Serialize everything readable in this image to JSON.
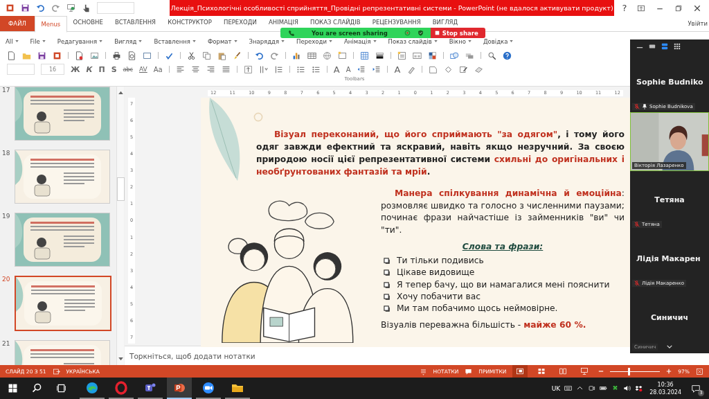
{
  "title_bar": {
    "title": "Лекція_Психологічні особливості сприйняття_Провідні репрезентативні системи -  PowerPoint (не вдалося активувати продукт)",
    "help": "?"
  },
  "ribbon_tabs": [
    {
      "label": "ФАЙЛ",
      "kind": "file",
      "selected": false
    },
    {
      "label": "Menus",
      "kind": "tab",
      "selected": true
    },
    {
      "label": "ОСНОВНЕ",
      "kind": "tab",
      "selected": false
    },
    {
      "label": "ВСТАВЛЕННЯ",
      "kind": "tab",
      "selected": false
    },
    {
      "label": "КОНСТРУКТОР",
      "kind": "tab",
      "selected": false
    },
    {
      "label": "ПЕРЕХОДИ",
      "kind": "tab",
      "selected": false
    },
    {
      "label": "АНІМАЦІЯ",
      "kind": "tab",
      "selected": false
    },
    {
      "label": "ПОКАЗ СЛАЙДІВ",
      "kind": "tab",
      "selected": false
    },
    {
      "label": "РЕЦЕНЗУВАННЯ",
      "kind": "tab",
      "selected": false
    },
    {
      "label": "ВИГЛЯД",
      "kind": "tab",
      "selected": false
    }
  ],
  "sign_in": "Увійти",
  "share_bar": {
    "status": "You are screen sharing",
    "stop": "Stop share"
  },
  "menus": [
    "All",
    "File",
    "Редагування",
    "Вигляд",
    "Вставлення",
    "Формат",
    "Знаряддя",
    "Переходи",
    "Анімація",
    "Показ слайдів",
    "Вікно",
    "Довідка"
  ],
  "font_size": "16",
  "format_buttons": [
    {
      "label": "Ж",
      "kind": "bold"
    },
    {
      "label": "К",
      "kind": "italic"
    },
    {
      "label": "П",
      "kind": "underline"
    },
    {
      "label": "S",
      "kind": "shadow"
    },
    {
      "label": "abc",
      "kind": "strike"
    },
    {
      "label": "AV",
      "kind": "spacing"
    },
    {
      "label": "Aa",
      "kind": "case"
    }
  ],
  "size_buttons": [
    {
      "label": "A",
      "kind": "grow"
    },
    {
      "label": "A",
      "kind": "shrink"
    }
  ],
  "font_color": "A",
  "toolbars_label": "Toolbars",
  "slides": [
    {
      "number": "17",
      "selected": false,
      "kind": "teal"
    },
    {
      "number": "18",
      "selected": false,
      "kind": "cream"
    },
    {
      "number": "19",
      "selected": false,
      "kind": "teal"
    },
    {
      "number": "20",
      "selected": true,
      "kind": "cream"
    },
    {
      "number": "21",
      "selected": false,
      "kind": "cream"
    }
  ],
  "ruler": {
    "horizontal": [
      "12",
      "11",
      "10",
      "9",
      "8",
      "7",
      "6",
      "5",
      "4",
      "3",
      "2",
      "1",
      "0",
      "1",
      "2",
      "3",
      "4",
      "5",
      "6",
      "7",
      "8",
      "9",
      "10",
      "11",
      "12"
    ],
    "vertical": [
      "7",
      "6",
      "5",
      "4",
      "3",
      "2",
      "1",
      "0",
      "1",
      "2",
      "3",
      "4",
      "5",
      "6",
      "7"
    ]
  },
  "slide": {
    "intro": "**Візуал переконаний, що його сприймають \"за одягом\"**, і тому його одяг завжди ефектний та яскравий, навіть якщо незручний. За своєю природою носії цієї репрезентативної системи **схильні до оригінальних і необґрунтованих фантазій та мрій**.",
    "manner": "**Манера спілкування динамічна й емоційна**: розмовляє швидко та голосно з численними паузами; починає фрази найчастіше із займенників \"ви\" чи \"ти\".",
    "heading": "Слова та фрази:",
    "phrases": [
      "Ти тільки подивись",
      "Цікаве видовище",
      "Я тепер бачу, що ви намагалися мені пояснити",
      "Хочу побачити вас",
      "Ми там побачимо щось неймовірне."
    ],
    "summary": "Візуалів переважна більшість - **майже 60 %.**"
  },
  "notes_placeholder": "Торкніться, щоб додати нотатки",
  "participants": [
    {
      "kind": "name",
      "display_name": "Sophie Budniko",
      "label": "Sophie Budnikova",
      "muted": true,
      "pinned": true,
      "active": false
    },
    {
      "kind": "video",
      "label": "Вікторія Лазаренко",
      "muted": false,
      "pinned": false,
      "active": true
    },
    {
      "kind": "name",
      "display_name": "Тетяна",
      "label": "Тетяна",
      "muted": true,
      "pinned": false,
      "active": false
    },
    {
      "kind": "name",
      "display_name": "Лідія Макарен",
      "label": "Лідія Макаренко",
      "muted": true,
      "pinned": false,
      "active": false
    },
    {
      "kind": "name",
      "display_name": "Синичич",
      "label": "Синичич",
      "muted": false,
      "pinned": false,
      "active": false
    }
  ],
  "status_bar": {
    "slide": "СЛАЙД 20 З 51",
    "language": "УКРАЇНСЬКА",
    "notes": "НОТАТКИ",
    "comments": "ПРИМІТКИ",
    "views": [
      {
        "kind": "normal",
        "selected": true
      },
      {
        "kind": "sorter",
        "selected": false
      },
      {
        "kind": "reading",
        "selected": false
      },
      {
        "kind": "show",
        "selected": false
      }
    ],
    "zoom": {
      "level": 0.35
    },
    "zoom_text": "97%"
  },
  "taskbar": {
    "apps": [
      {
        "kind": "edge",
        "selected": false
      },
      {
        "kind": "opera",
        "selected": false
      },
      {
        "kind": "teams",
        "selected": false
      },
      {
        "kind": "powerpoint",
        "selected": true
      },
      {
        "kind": "zoom",
        "selected": false
      },
      {
        "kind": "explorer",
        "selected": false
      }
    ],
    "language": "UK",
    "time": "10:36",
    "date": "28.03.2024",
    "notifications": "3"
  }
}
